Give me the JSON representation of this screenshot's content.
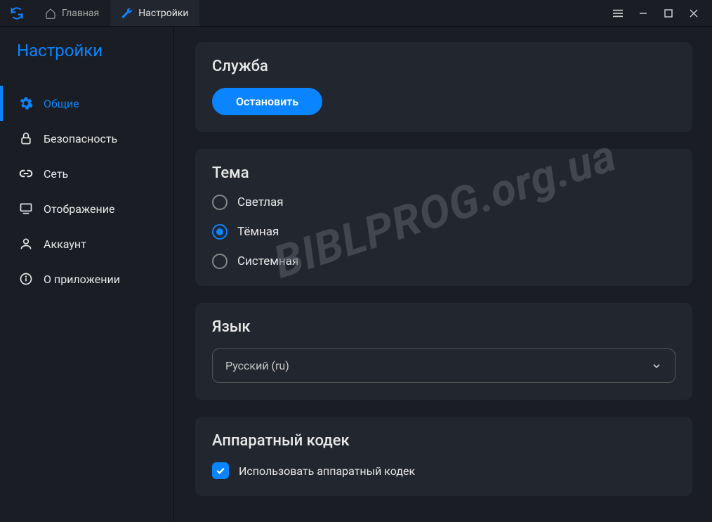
{
  "titlebar": {
    "tabs": [
      {
        "label": "Главная"
      },
      {
        "label": "Настройки"
      }
    ]
  },
  "sidebar": {
    "title": "Настройки",
    "items": [
      {
        "label": "Общие"
      },
      {
        "label": "Безопасность"
      },
      {
        "label": "Сеть"
      },
      {
        "label": "Отображение"
      },
      {
        "label": "Аккаунт"
      },
      {
        "label": "О приложении"
      }
    ]
  },
  "service": {
    "title": "Служба",
    "stop_label": "Остановить"
  },
  "theme": {
    "title": "Тема",
    "options": [
      {
        "label": "Светлая"
      },
      {
        "label": "Тёмная"
      },
      {
        "label": "Системная"
      }
    ],
    "selected_index": 1
  },
  "language": {
    "title": "Язык",
    "selected": "Русский (ru)"
  },
  "codec": {
    "title": "Аппаратный кодек",
    "checkbox_label": "Использовать аппаратный кодек",
    "checked": true
  },
  "watermark": "BIBLPROG.org.ua"
}
